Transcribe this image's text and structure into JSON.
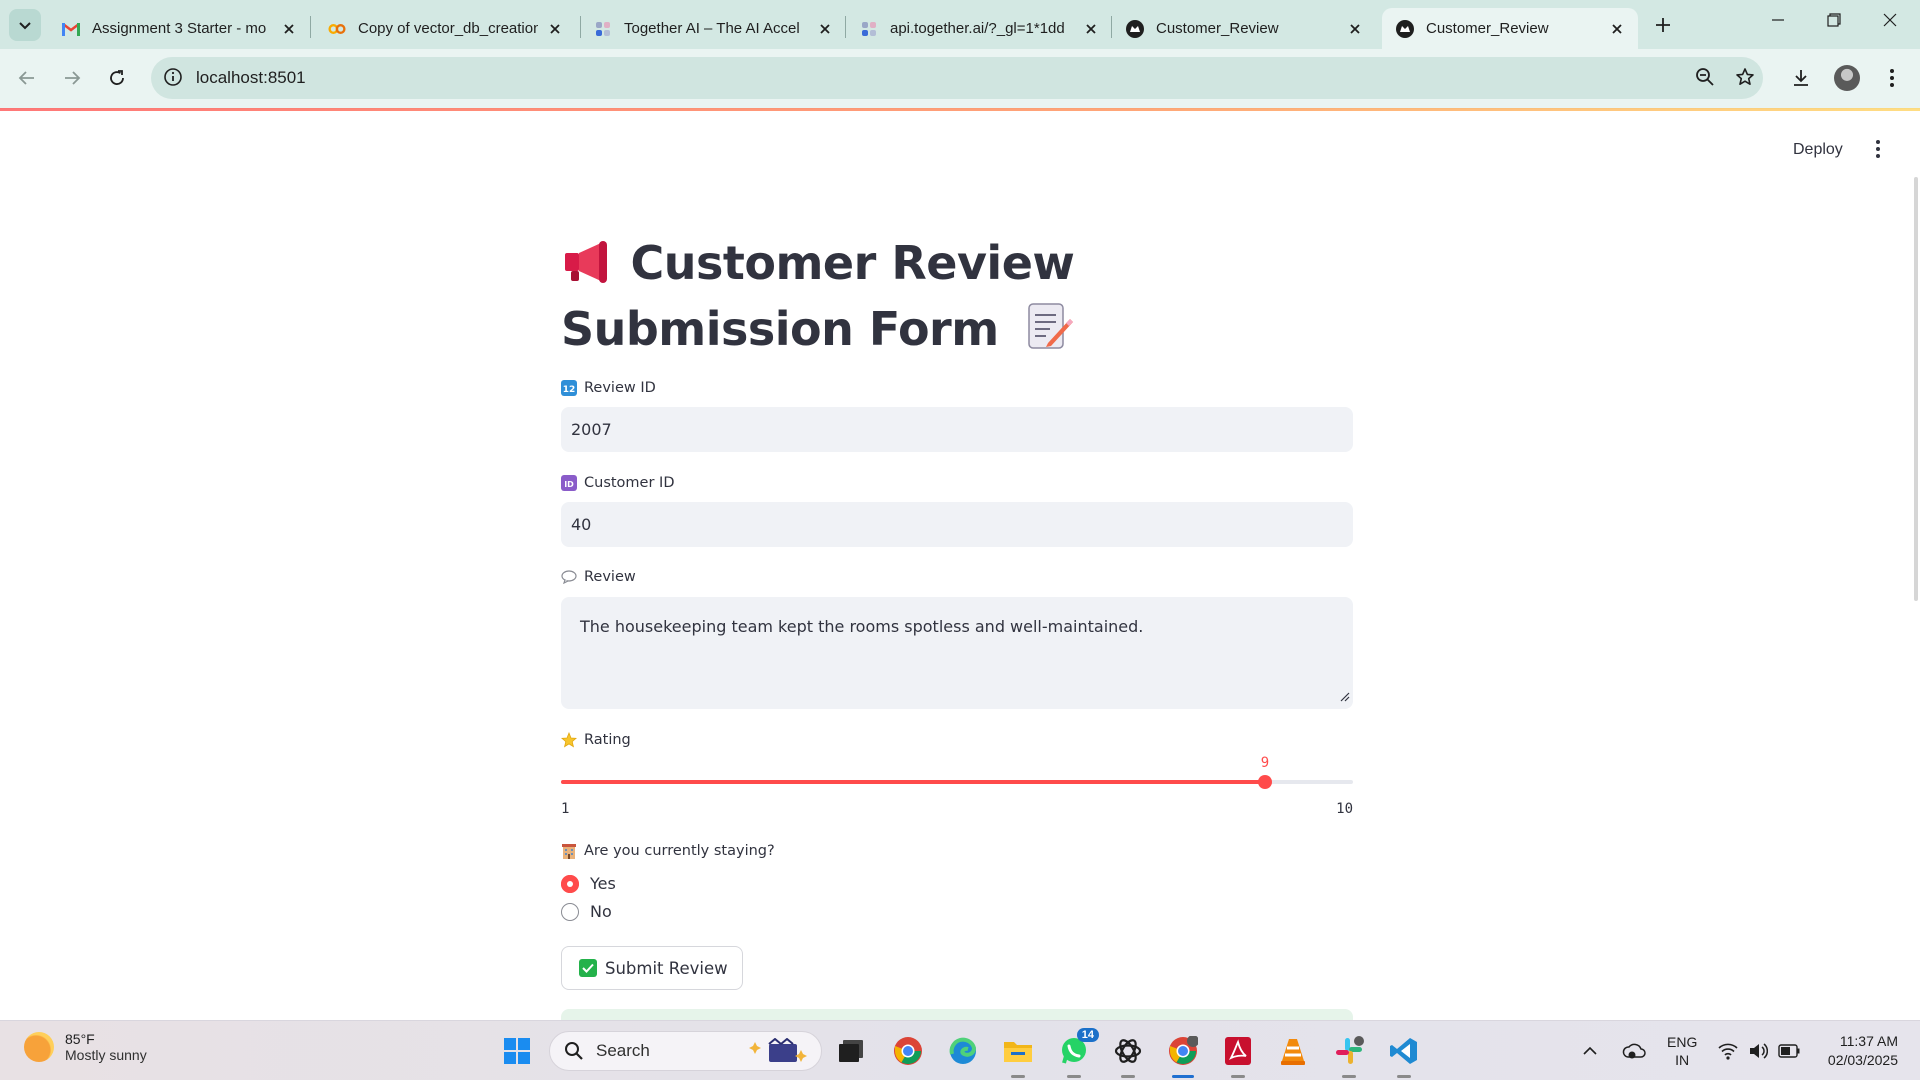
{
  "browser": {
    "tabs": [
      {
        "title": "Assignment 3 Starter - mo",
        "favicon": "gmail-icon"
      },
      {
        "title": "Copy of vector_db_creation",
        "favicon": "colab-icon"
      },
      {
        "title": "Together AI – The AI Accel",
        "favicon": "together-icon"
      },
      {
        "title": "api.together.ai/?_gl=1*1dd",
        "favicon": "together-icon"
      },
      {
        "title": "Customer_Review",
        "favicon": "streamlit-icon"
      },
      {
        "title": "Customer_Review",
        "favicon": "streamlit-icon",
        "active": true
      }
    ],
    "url": "localhost:8501"
  },
  "app": {
    "deploy_label": "Deploy",
    "title_text": "Customer Review Submission Form",
    "title_emoji_start": "megaphone-icon",
    "title_emoji_end": "memo-icon",
    "fields": {
      "review_id": {
        "label": "Review ID",
        "value": "2007"
      },
      "customer_id": {
        "label": "Customer ID",
        "value": "40"
      },
      "review": {
        "label": "Review",
        "value": "The housekeeping team kept the rooms spotless and well-maintained."
      }
    },
    "rating": {
      "label": "Rating",
      "min": 1,
      "max": 10,
      "value": 9,
      "min_label": "1",
      "max_label": "10",
      "value_label": "9"
    },
    "staying": {
      "label": "Are you currently staying?",
      "options": [
        "Yes",
        "No"
      ],
      "selected": "Yes"
    },
    "submit_label": "Submit Review"
  },
  "taskbar": {
    "weather_temp": "85°F",
    "weather_desc": "Mostly sunny",
    "search_placeholder": "Search",
    "whatsapp_badge": "14",
    "lang_1": "ENG",
    "lang_2": "IN",
    "time": "11:37 AM",
    "date": "02/03/2025"
  },
  "colors": {
    "accent": "#ff4b4b",
    "browser_frame": "#d3e8e3",
    "input_bg": "#f0f2f6"
  }
}
